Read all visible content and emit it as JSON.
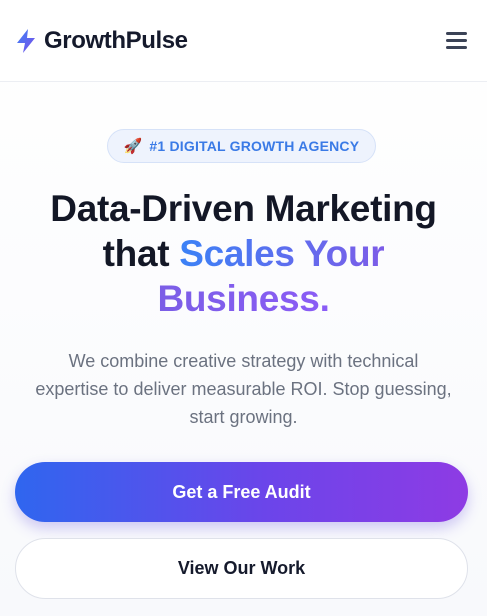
{
  "header": {
    "brand": "GrowthPulse",
    "logo_icon": "lightning-bolt-icon",
    "menu_icon": "hamburger-menu-icon"
  },
  "badge": {
    "icon": "rocket-icon",
    "glyph": "🚀",
    "text": "#1 DIGITAL GROWTH AGENCY"
  },
  "hero": {
    "headline_line1": "Data-Driven Marketing",
    "headline_line2_plain": "that ",
    "headline_line2_accent": "Scales Your",
    "headline_line3_accent": "Business.",
    "subtitle": "We combine creative strategy with technical expertise to deliver measurable ROI. Stop guessing, start growing."
  },
  "cta": {
    "primary_label": "Get a Free Audit",
    "secondary_label": "View Our Work"
  },
  "colors": {
    "brand_blue": "#3b82f6",
    "brand_purple": "#8b5cf6",
    "text_dark": "#131726",
    "text_muted": "#6b7280"
  }
}
